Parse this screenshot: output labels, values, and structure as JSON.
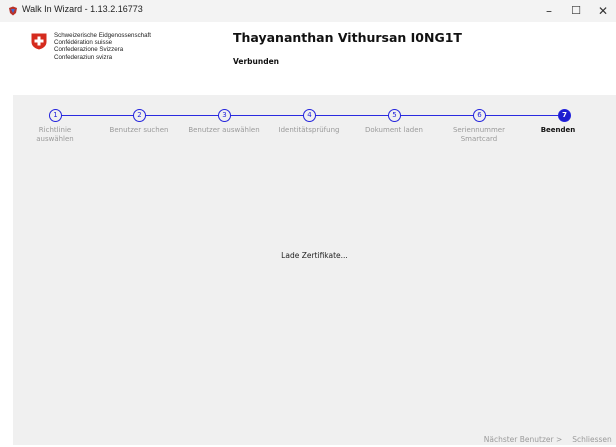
{
  "window": {
    "title": "Walk In Wizard - 1.13.2.16773",
    "controls": {
      "minimize": "–",
      "maximize": "☐",
      "close": "✕"
    }
  },
  "header": {
    "confederation": [
      "Schweizerische Eidgenossenschaft",
      "Confédération suisse",
      "Confederazione Svizzera",
      "Confederaziun svizra"
    ],
    "user_name": "Thayananthan Vithursan I0NG1T",
    "connection_status": "Verbunden"
  },
  "wizard": {
    "steps": [
      {
        "number": "1",
        "label_line1": "Richtlinie",
        "label_line2": "auswählen"
      },
      {
        "number": "2",
        "label_line1": "Benutzer suchen",
        "label_line2": ""
      },
      {
        "number": "3",
        "label_line1": "Benutzer auswählen",
        "label_line2": ""
      },
      {
        "number": "4",
        "label_line1": "Identitätsprüfung",
        "label_line2": ""
      },
      {
        "number": "5",
        "label_line1": "Dokument laden",
        "label_line2": ""
      },
      {
        "number": "6",
        "label_line1": "Seriennummer",
        "label_line2": "Smartcard"
      },
      {
        "number": "7",
        "label_line1": "Beenden",
        "label_line2": ""
      }
    ],
    "active_step": 7,
    "status_message": "Lade Zertifikate..."
  },
  "buttons": {
    "next_user": "Nächster Benutzer >",
    "close": "Schliessen"
  },
  "colors": {
    "step_accent": "#2323dd",
    "panel_bg": "#f0f0f0",
    "flag_red": "#d52b1e"
  }
}
